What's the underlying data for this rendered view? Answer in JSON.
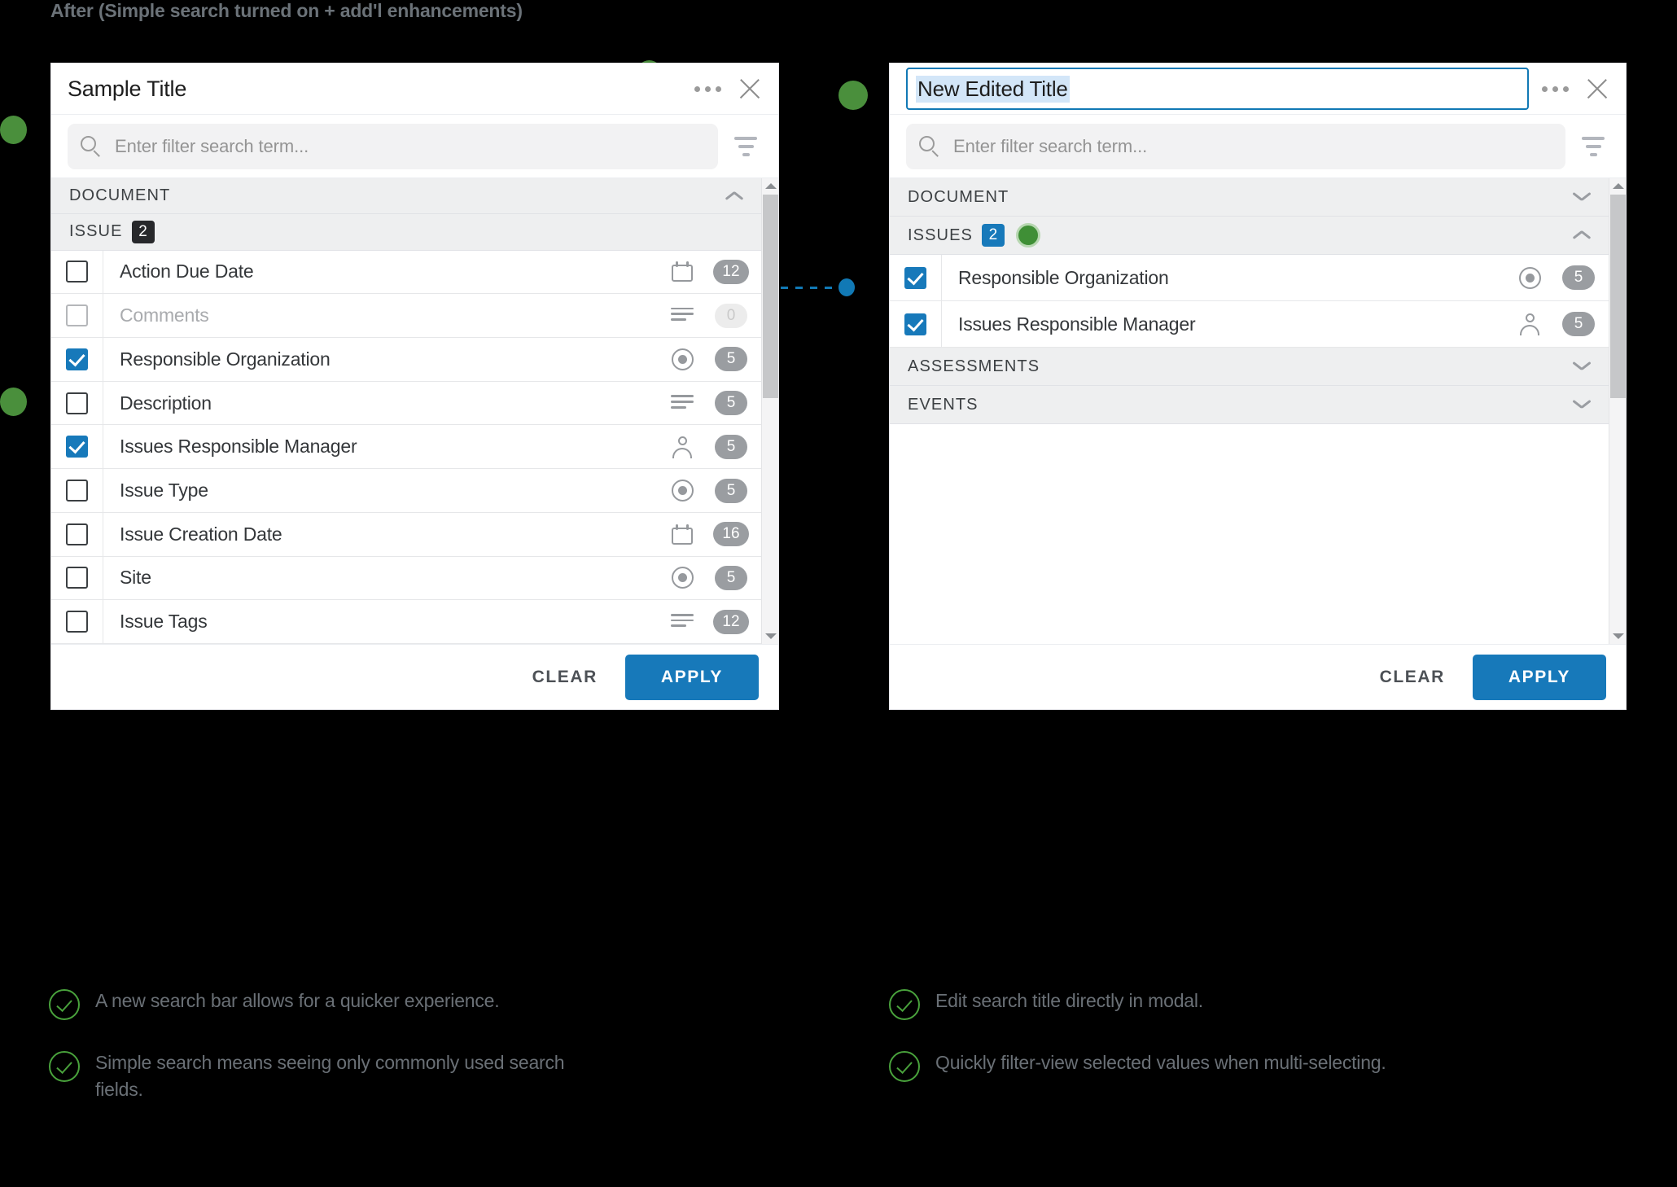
{
  "caption": "After (Simple search turned on + add'l enhancements)",
  "colors": {
    "accent_blue": "#1779ba",
    "green": "#4a8f3c",
    "dark_badge": "#27282b",
    "grey_pill": "#9a9da1",
    "background": "#000000"
  },
  "left_panel": {
    "title": "Sample Title",
    "kebab_label": "more-options",
    "close_label": "close",
    "search": {
      "placeholder": "Enter filter search term...",
      "value": "",
      "search_icon": "search-icon",
      "filter_icon": "filter-icon"
    },
    "groups": [
      {
        "label": "DOCUMENT",
        "expanded": true,
        "chevron": "chevron-up-icon"
      },
      {
        "label": "ISSUE",
        "badge": "2",
        "expanded": true,
        "chevron": ""
      }
    ],
    "rows": [
      {
        "label": "Action Due Date",
        "checked": false,
        "muted": false,
        "icon": "calendar-icon",
        "count": "12"
      },
      {
        "label": "Comments",
        "checked": false,
        "muted": true,
        "icon": "text-lines-icon",
        "count": "0"
      },
      {
        "label": "Responsible Organization",
        "checked": true,
        "muted": false,
        "icon": "radio-icon",
        "count": "5"
      },
      {
        "label": "Description",
        "checked": false,
        "muted": false,
        "icon": "text-lines-icon",
        "count": "5"
      },
      {
        "label": "Issues Responsible Manager",
        "checked": true,
        "muted": false,
        "icon": "person-icon",
        "count": "5"
      },
      {
        "label": "Issue Type",
        "checked": false,
        "muted": false,
        "icon": "radio-icon",
        "count": "5"
      },
      {
        "label": "Issue Creation Date",
        "checked": false,
        "muted": false,
        "icon": "calendar-icon",
        "count": "16"
      },
      {
        "label": "Site",
        "checked": false,
        "muted": false,
        "icon": "radio-icon",
        "count": "5"
      },
      {
        "label": "Issue Tags",
        "checked": false,
        "muted": false,
        "icon": "text-lines-icon",
        "count": "12"
      }
    ],
    "footer": {
      "clear_label": "CLEAR",
      "apply_label": "APPLY"
    }
  },
  "right_panel": {
    "title_value": "New Edited Title",
    "title_selected": true,
    "kebab_label": "more-options",
    "close_label": "close",
    "search": {
      "placeholder": "Enter filter search term...",
      "value": "",
      "search_icon": "search-icon",
      "filter_icon": "filter-icon"
    },
    "groups": [
      {
        "label": "DOCUMENT",
        "badge": "",
        "expanded": false,
        "chevron": "chevron-down-icon",
        "green_dot": false
      },
      {
        "label": "ISSUES",
        "badge": "2",
        "expanded": true,
        "chevron": "chevron-up-icon",
        "green_dot": true
      },
      {
        "label": "ASSESSMENTS",
        "badge": "",
        "expanded": false,
        "chevron": "chevron-down-icon",
        "green_dot": false
      },
      {
        "label": "EVENTS",
        "badge": "",
        "expanded": false,
        "chevron": "chevron-down-icon",
        "green_dot": false
      }
    ],
    "rows": [
      {
        "label": "Responsible Organization",
        "checked": true,
        "icon": "radio-icon",
        "count": "5"
      },
      {
        "label": "Issues Responsible Manager",
        "checked": true,
        "icon": "person-icon",
        "count": "5"
      }
    ],
    "footer": {
      "clear_label": "CLEAR",
      "apply_label": "APPLY"
    }
  },
  "annotations": {
    "left": [
      "A new search bar allows for a quicker experience.",
      "Simple search means seeing only commonly used search fields."
    ],
    "right": [
      "Edit search title directly in modal.",
      "Quickly filter-view selected values when multi-selecting."
    ]
  }
}
